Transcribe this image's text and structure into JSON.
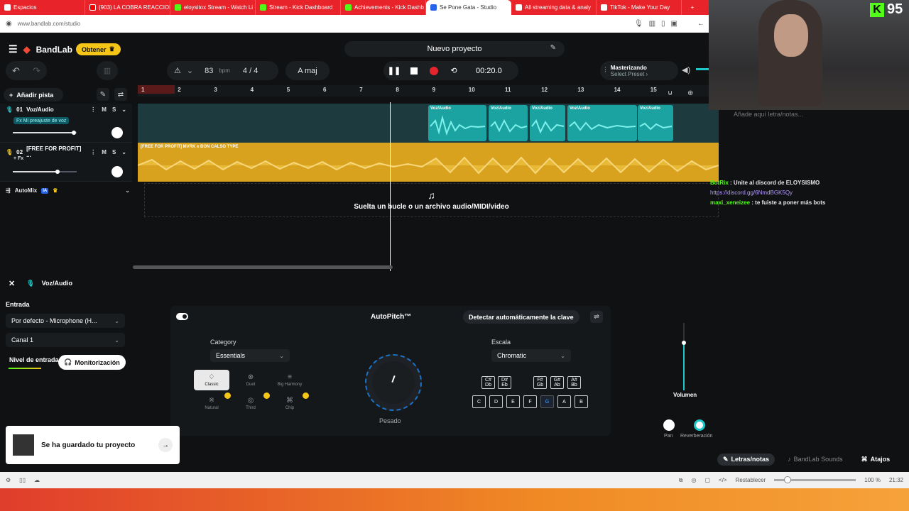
{
  "browser": {
    "tabs": [
      {
        "label": "Espacios",
        "kind": "plain"
      },
      {
        "label": "(903) LA COBRA REACCIONA",
        "kind": "yt"
      },
      {
        "label": "eloysitox Stream - Watch Li",
        "kind": "kick"
      },
      {
        "label": "Stream - Kick Dashboard",
        "kind": "kick"
      },
      {
        "label": "Achievements - Kick Dashb",
        "kind": "kick"
      },
      {
        "label": "Se Pone Gata - Studio",
        "kind": "active"
      },
      {
        "label": "All streaming data & analy",
        "kind": "plain"
      },
      {
        "label": "TikTok - Make Your Day",
        "kind": "plain"
      }
    ],
    "new_tab": "+",
    "url": "www.bandlab.com/studio"
  },
  "app": {
    "logo": "BandLab",
    "get_label": "Obtener",
    "project_title": "Nuevo proyecto",
    "bpm": "83",
    "bpm_unit": "bpm",
    "time_sig": "4 / 4",
    "key": "A maj",
    "time": "00:20.0",
    "mastering_title": "Masterizando",
    "mastering_sub": "Select Preset ›"
  },
  "tracks": {
    "add_label": "Añadir pista",
    "items": [
      {
        "num": "01",
        "name": "Voz/Audio",
        "fx": "Fx Mi preajuste de voz",
        "m": "M",
        "s": "S",
        "volume": 0.95
      },
      {
        "num": "02",
        "name": "[FREE FOR PROFIT] ...",
        "fx": "+ Fx",
        "m": "M",
        "s": "S",
        "volume": 0.7
      }
    ],
    "automix": "AutoMix"
  },
  "timeline": {
    "bars": [
      "1",
      "2",
      "3",
      "4",
      "5",
      "6",
      "7",
      "8",
      "9",
      "10",
      "11",
      "12",
      "13",
      "14",
      "15"
    ],
    "clip_label": "Voz/Audio",
    "beat_label": "[FREE FOR PROFIT] MVRK x BON CALSO TYPE",
    "drop_text": "Suelta un bucle o un archivo audio/MIDI/video"
  },
  "overlay": {
    "kick_count": "95",
    "lyrics_placeholder": "Añade aquí letra/notas...",
    "chat": [
      {
        "user": "BotRix",
        "text": ": Unite al discord de ELOYSISMO"
      },
      {
        "user": "",
        "text": "https://discord.gg/6NmdBGK5Qy"
      },
      {
        "user": "maxi_xeneizee",
        "text": ": te fuiste a poner más bots"
      }
    ]
  },
  "panel": {
    "track_name": "Voz/Audio",
    "input_label": "Entrada",
    "input_device": "Por defecto - Microphone (H...",
    "channel": "Canal 1",
    "level_label": "Nivel de entrada",
    "monitor_label": "Monitorización",
    "autopitch": {
      "title": "AutoPitch™",
      "detect": "Detectar automáticamente la clave",
      "category_label": "Category",
      "category_value": "Essentials",
      "scale_label": "Escala",
      "scale_value": "Chromatic",
      "styles": [
        "Classic",
        "Duet",
        "Big Harmony",
        "Natural",
        "Third",
        "Chip"
      ],
      "dial_label": "Pesado",
      "sharps": [
        "C# Db",
        "D# Eb",
        "F# Gb",
        "G# Ab",
        "A# Bb"
      ],
      "naturals": [
        "C",
        "D",
        "E",
        "F",
        "G",
        "A",
        "B"
      ],
      "selected_note": "G"
    },
    "volume_label": "Volumen",
    "volume_level": 0.7,
    "pan_label": "Pan",
    "reverb_label": "Reverberación"
  },
  "toast": {
    "text": "Se ha guardado tu proyecto"
  },
  "bottom_tabs": {
    "lyrics": "Letras/notas",
    "sounds": "BandLab Sounds",
    "shortcuts": "Atajos"
  },
  "status": {
    "reset": "Restablecer",
    "zoom": "100 %",
    "clock": "21:32"
  }
}
